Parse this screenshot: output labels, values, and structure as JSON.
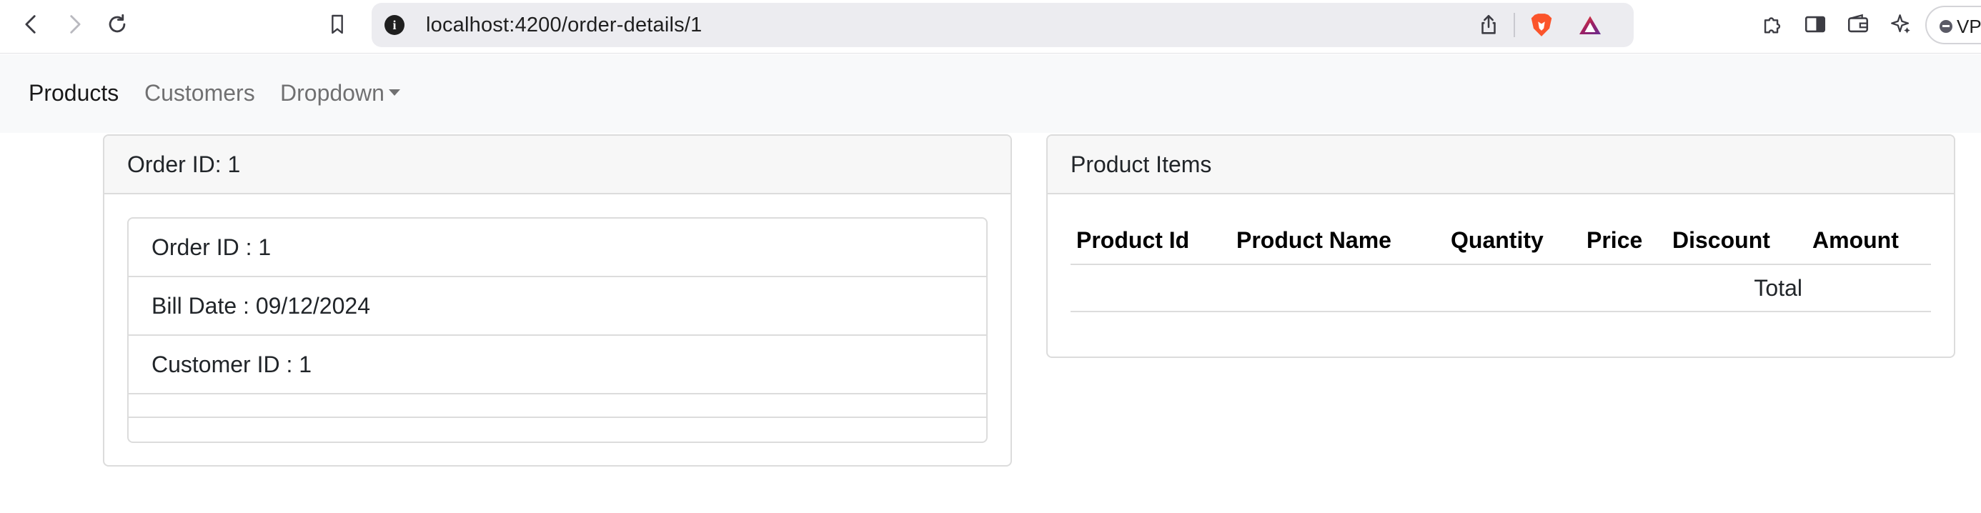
{
  "browser": {
    "url": "localhost:4200/order-details/1",
    "info_icon": "info-icon",
    "vpn_label": "VPN"
  },
  "navbar": {
    "links": [
      {
        "label": "Products",
        "active": true
      },
      {
        "label": "Customers",
        "active": false
      },
      {
        "label": "Dropdown",
        "active": false
      }
    ]
  },
  "order_card": {
    "header": "Order ID: 1",
    "items": [
      "Order ID : 1",
      "Bill Date : 09/12/2024",
      "Customer ID : 1",
      "",
      ""
    ]
  },
  "products_card": {
    "header": "Product Items",
    "columns": [
      "Product Id",
      "Product Name",
      "Quantity",
      "Price",
      "Discount",
      "Amount"
    ],
    "total_label": "Total",
    "total_value": ""
  },
  "colors": {
    "navbar_bg": "#f8f9fa",
    "card_header_bg": "#f7f7f7",
    "border": "#dcdcdc",
    "brave_orange": "#fb542b"
  }
}
